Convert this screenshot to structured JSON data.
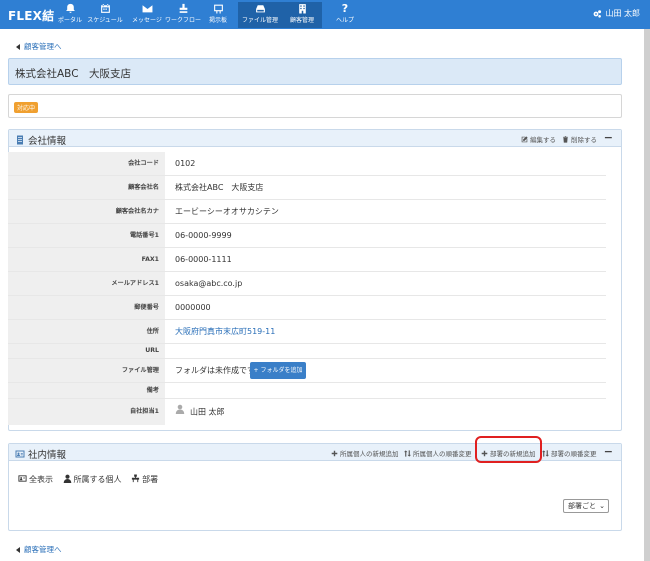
{
  "app": {
    "brand": "FLEX結"
  },
  "nav": [
    {
      "icon": "bell-icon",
      "label": "ポータル"
    },
    {
      "icon": "calendar-icon",
      "label": "スケジュール"
    },
    {
      "icon": "envelope-icon",
      "label": "メッセージ"
    },
    {
      "icon": "stamp-icon",
      "label": "ワークフロー"
    },
    {
      "icon": "board-icon",
      "label": "掲示板"
    },
    {
      "icon": "drive-icon",
      "label": "ファイル管理"
    },
    {
      "icon": "building-icon",
      "label": "顧客管理"
    },
    {
      "icon": "question-icon",
      "label": "ヘルプ"
    }
  ],
  "user": {
    "name": "山田 太郎"
  },
  "back_link": "顧客管理へ",
  "page_title": "株式会社ABC　大阪支店",
  "status_badge": "対応中",
  "company_panel": {
    "title": "会社情報",
    "edit": "編集する",
    "delete": "削除する",
    "collapse": "−",
    "rows": [
      {
        "label": "会社コード",
        "value": "0102"
      },
      {
        "label": "顧客会社名",
        "value": "株式会社ABC　大阪支店"
      },
      {
        "label": "顧客会社名カナ",
        "value": "エービーシーオオサカシテン"
      },
      {
        "label": "電話番号1",
        "value": "06-0000-9999"
      },
      {
        "label": "FAX1",
        "value": "06-0000-1111"
      },
      {
        "label": "メールアドレス1",
        "value": "osaka@abc.co.jp"
      },
      {
        "label": "郵便番号",
        "value": "0000000"
      },
      {
        "label": "住所",
        "value": "大阪府門真市末広町519-11"
      },
      {
        "label": "URL",
        "value": ""
      },
      {
        "label": "ファイル管理",
        "value": "フォルダは未作成です。"
      },
      {
        "label": "備考",
        "value": ""
      },
      {
        "label": "自社担当1",
        "value": "山田 太郎"
      }
    ],
    "folder_button": "+ フォルダを追加"
  },
  "internal_panel": {
    "title": "社内情報",
    "actions": {
      "add_person": "所属個人の新規追加",
      "reorder_person": "所属個人の順番変更",
      "add_dept": "部署の新規追加",
      "reorder_dept": "部署の順番変更"
    },
    "collapse": "−",
    "tabs": [
      "全表示",
      "所属する個人",
      "部署"
    ],
    "select_value": "部署ごと"
  },
  "colors": {
    "nav_bg": "#2f7fd3",
    "accent_link": "#2a6fb8",
    "badge": "#f0a030",
    "highlight": "#e02020"
  }
}
